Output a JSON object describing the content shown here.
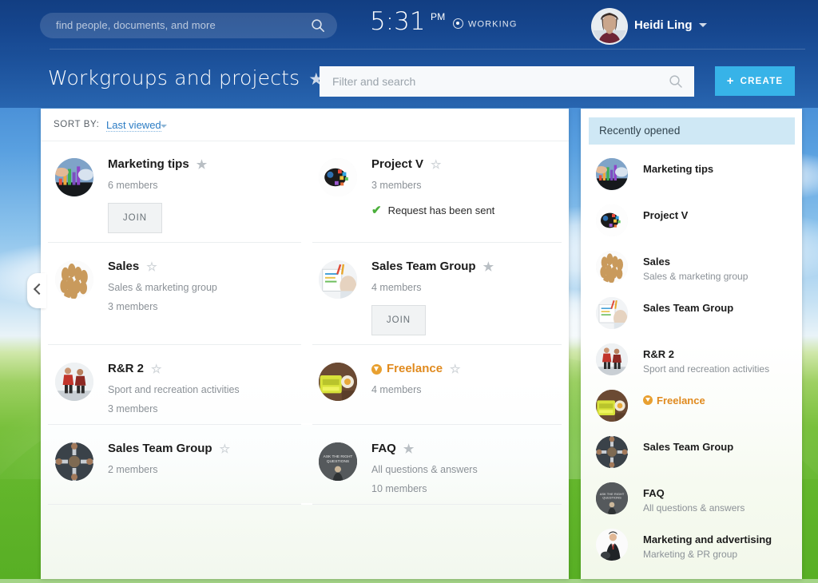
{
  "header": {
    "global_search_placeholder": "find people, documents, and more",
    "search_icon": "search-icon",
    "time": "5:31",
    "time_meridiem": "PM",
    "status_label": "WORKING",
    "status_icon": "record-dot-icon",
    "user_name": "Heidi Ling",
    "user_caret_icon": "chevron-down-icon",
    "avatar_icon": "user-avatar"
  },
  "page": {
    "title": "Workgroups and projects",
    "title_star_icon": "star-filled-icon",
    "filter_placeholder": "Filter and search",
    "filter_icon": "search-icon",
    "create_label": "CREATE",
    "create_plus": "+",
    "collapse_icon": "chevron-left-icon",
    "accent_color": "#37b3e8",
    "header_bg_color": "#154489",
    "link_color": "#2b7cc4",
    "orange_color": "#e08a1e",
    "green_color": "#4aaf3a"
  },
  "sort": {
    "label": "SORT BY:",
    "value": "Last viewed",
    "caret_icon": "chevron-down-icon"
  },
  "groups": [
    {
      "name": "Marketing tips",
      "starred": true,
      "star_icon": "star-filled-icon",
      "description": "",
      "members": "6 members",
      "action": "JOIN",
      "action_type": "join",
      "avatar": "chart-hands",
      "highlight": false
    },
    {
      "name": "Project V",
      "starred": false,
      "star_icon": "star-outline-icon",
      "description": "",
      "members": "3 members",
      "action": "Request has been sent",
      "action_type": "sent",
      "action_icon": "check-icon",
      "avatar": "paint-splash",
      "highlight": false
    },
    {
      "name": "Sales",
      "starred": false,
      "star_icon": "star-outline-icon",
      "description": "Sales & marketing group",
      "members": "3 members",
      "action": "",
      "action_type": "none",
      "avatar": "peanuts",
      "highlight": false
    },
    {
      "name": "Sales Team Group",
      "starred": true,
      "star_icon": "star-filled-icon",
      "description": "",
      "members": "4 members",
      "action": "JOIN",
      "action_type": "join",
      "avatar": "desk-papers",
      "highlight": false
    },
    {
      "name": "R&R 2",
      "starred": false,
      "star_icon": "star-outline-icon",
      "description": "Sport and recreation activities",
      "members": "3 members",
      "action": "",
      "action_type": "none",
      "avatar": "runners",
      "highlight": false
    },
    {
      "name": "Freelance",
      "starred": false,
      "star_icon": "star-outline-icon",
      "description": "",
      "members": "4 members",
      "action": "",
      "action_type": "none",
      "avatar": "yellow-typewriter",
      "highlight": true,
      "badge_icon": "extranet-badge-icon"
    },
    {
      "name": "Sales Team Group",
      "starred": false,
      "star_icon": "star-outline-icon",
      "description": "",
      "members": "2 members",
      "action": "",
      "action_type": "none",
      "avatar": "team-huddle",
      "highlight": false
    },
    {
      "name": "FAQ",
      "starred": true,
      "star_icon": "star-filled-icon",
      "description": "All questions & answers",
      "members": "10 members",
      "action": "",
      "action_type": "none",
      "avatar": "ask-questions",
      "highlight": false
    }
  ],
  "sidebar": {
    "title": "Recently opened",
    "items": [
      {
        "name": "Marketing tips",
        "description": "",
        "avatar": "chart-hands",
        "highlight": false
      },
      {
        "name": "Project V",
        "description": "",
        "avatar": "paint-splash",
        "highlight": false
      },
      {
        "name": "Sales",
        "description": "Sales & marketing group",
        "avatar": "peanuts",
        "highlight": false
      },
      {
        "name": "Sales Team Group",
        "description": "",
        "avatar": "desk-papers",
        "highlight": false
      },
      {
        "name": "R&R 2",
        "description": "Sport and recreation activities",
        "avatar": "runners",
        "highlight": false
      },
      {
        "name": "Freelance",
        "description": "",
        "avatar": "yellow-typewriter",
        "highlight": true,
        "badge_icon": "extranet-badge-icon"
      },
      {
        "name": "Sales Team Group",
        "description": "",
        "avatar": "team-huddle",
        "highlight": false
      },
      {
        "name": "FAQ",
        "description": "All questions & answers",
        "avatar": "ask-questions",
        "highlight": false
      },
      {
        "name": "Marketing and advertising",
        "description": "Marketing & PR group",
        "avatar": "businessman",
        "highlight": false
      }
    ]
  }
}
